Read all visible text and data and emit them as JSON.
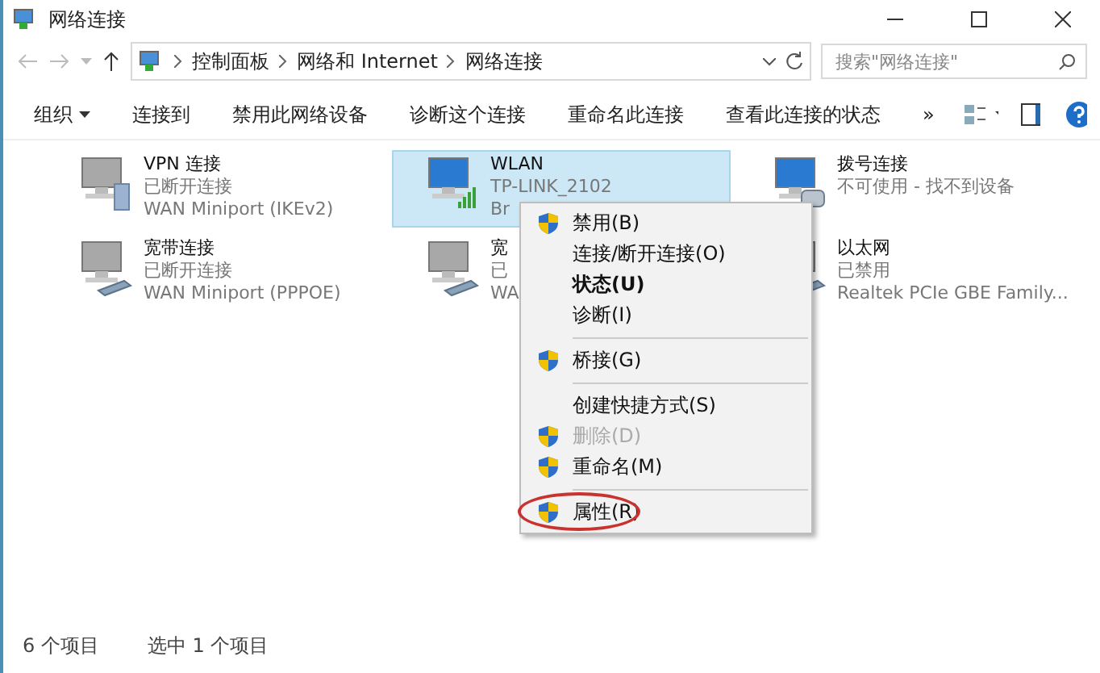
{
  "window": {
    "title": "网络连接"
  },
  "address": {
    "segments": [
      "控制面板",
      "网络和 Internet",
      "网络连接"
    ]
  },
  "search": {
    "placeholder": "搜索\"网络连接\""
  },
  "toolbar": {
    "items": [
      {
        "label": "组织",
        "kind": "dropdown"
      },
      {
        "label": "连接到",
        "kind": "plain"
      },
      {
        "label": "禁用此网络设备",
        "kind": "plain"
      },
      {
        "label": "诊断这个连接",
        "kind": "plain"
      },
      {
        "label": "重命名此连接",
        "kind": "plain"
      },
      {
        "label": "查看此连接的状态",
        "kind": "plain"
      }
    ],
    "more": "»"
  },
  "connections": [
    {
      "name": "VPN 连接",
      "status": "已断开连接",
      "device": "WAN Miniport (IKEv2)",
      "kind": "vpn",
      "connected": false,
      "selected": false
    },
    {
      "name": "WLAN",
      "status": "TP-LINK_2102",
      "device": "Br",
      "kind": "wifi",
      "connected": true,
      "selected": true
    },
    {
      "name": "拨号连接",
      "status": "不可使用 - 找不到设备",
      "kind": "dialup",
      "connected": true,
      "selected": false
    },
    {
      "name": "宽带连接",
      "status": "已断开连接",
      "device": "WAN Miniport (PPPOE)",
      "kind": "broadband",
      "connected": false,
      "selected": false
    },
    {
      "name": "宽",
      "status": "已",
      "device": "WA",
      "kind": "broadband",
      "connected": false,
      "selected": false
    },
    {
      "name": "以太网",
      "status": "已禁用",
      "device": "Realtek PCIe GBE Family...",
      "kind": "ethernet",
      "connected": false,
      "selected": false
    }
  ],
  "context_menu": {
    "items": [
      {
        "kind": "item",
        "label": "禁用(B)",
        "shield": true,
        "bold": false,
        "disabled": false,
        "circled": false
      },
      {
        "kind": "item",
        "label": "连接/断开连接(O)",
        "shield": false,
        "bold": false,
        "disabled": false,
        "circled": false
      },
      {
        "kind": "item",
        "label": "状态(U)",
        "shield": false,
        "bold": true,
        "disabled": false,
        "circled": false
      },
      {
        "kind": "item",
        "label": "诊断(I)",
        "shield": false,
        "bold": false,
        "disabled": false,
        "circled": false
      },
      {
        "kind": "separator"
      },
      {
        "kind": "item",
        "label": "桥接(G)",
        "shield": true,
        "bold": false,
        "disabled": false,
        "circled": false
      },
      {
        "kind": "separator"
      },
      {
        "kind": "item",
        "label": "创建快捷方式(S)",
        "shield": false,
        "bold": false,
        "disabled": false,
        "circled": false
      },
      {
        "kind": "item",
        "label": "删除(D)",
        "shield": true,
        "bold": false,
        "disabled": true,
        "circled": false
      },
      {
        "kind": "item",
        "label": "重命名(M)",
        "shield": true,
        "bold": false,
        "disabled": false,
        "circled": false
      },
      {
        "kind": "separator"
      },
      {
        "kind": "item",
        "label": "属性(R)",
        "shield": true,
        "bold": false,
        "disabled": false,
        "circled": true
      }
    ]
  },
  "status_bar": {
    "count": "6 个项目",
    "selection": "选中 1 个项目"
  }
}
